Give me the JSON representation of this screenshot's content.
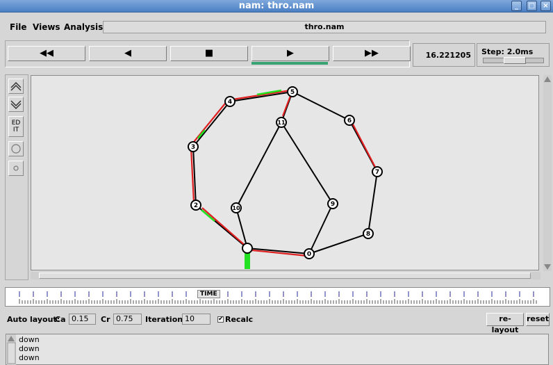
{
  "window": {
    "title": "nam: thro.nam"
  },
  "menu": {
    "file": "File",
    "views": "Views",
    "analysis": "Analysis",
    "filename": "thro.nam"
  },
  "controls": {
    "rewind": "◀◀",
    "back": "◀",
    "stop": "■",
    "play": "▶",
    "forward": "▶▶"
  },
  "time": {
    "current": "16.221205",
    "step_label": "Step: 2.0ms"
  },
  "tools": {
    "edit": "ED IT"
  },
  "timeline": {
    "label": "TIME"
  },
  "autolayout": {
    "label": "Auto layout:",
    "ca_label": "Ca",
    "ca_value": "0.15",
    "cr_label": "Cr",
    "cr_value": "0.75",
    "iter_label": "Iterations",
    "iter_value": "10",
    "recalc_label": "Recalc",
    "recalc_checked": "✔",
    "relayout": "re-layout",
    "reset": "reset"
  },
  "log": [
    "down",
    "down",
    "down"
  ],
  "nodes": [
    "0",
    "2",
    "3",
    "4",
    "5",
    "6",
    "7",
    "8",
    "9",
    "10",
    "11"
  ],
  "colors": {
    "title_bar": "#4a7fc4",
    "play_indicator": "#3aa374",
    "link_red": "#e02020",
    "packet_green": "#22e022"
  }
}
